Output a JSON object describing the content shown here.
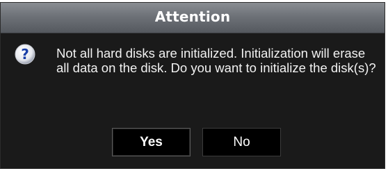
{
  "dialog": {
    "title": "Attention",
    "icon": "question-icon",
    "message": "Not all hard disks are initialized. Initialization will erase all data on the disk. Do you want to initialize the disk(s)?",
    "yes_label": "Yes",
    "no_label": "No"
  },
  "colors": {
    "background": "#1a1a1a",
    "titlebar": "#6d7177",
    "text": "#ffffff",
    "icon_blue": "#1a3fa8"
  }
}
